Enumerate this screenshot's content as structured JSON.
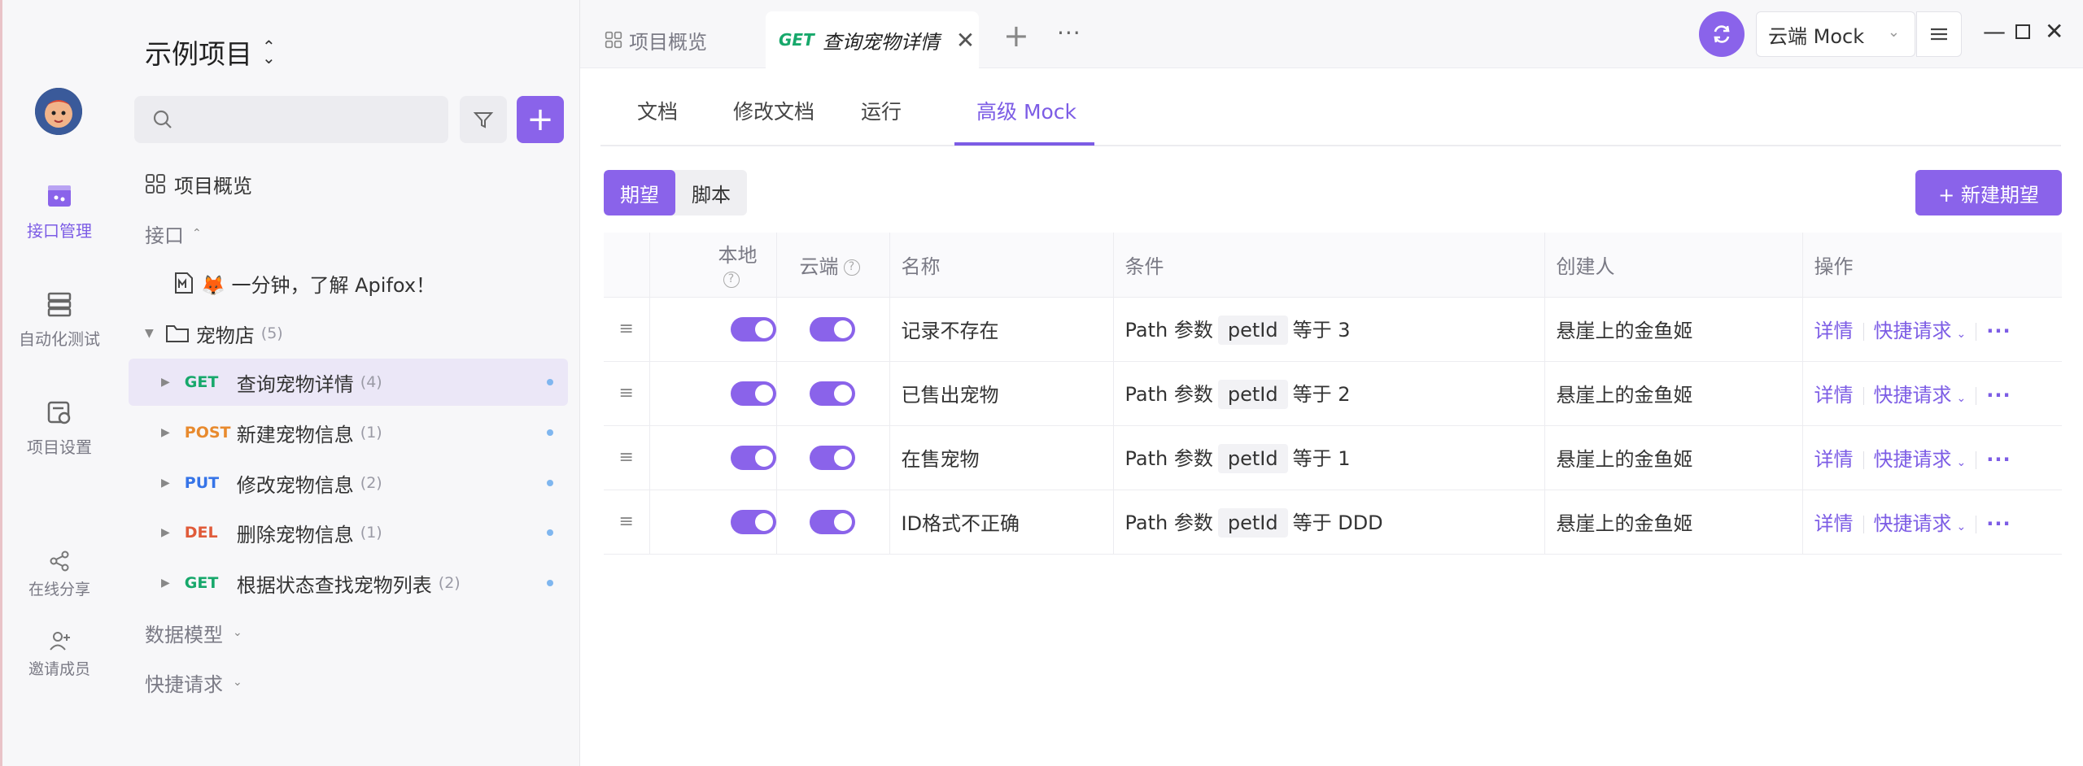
{
  "rail": {
    "items": [
      {
        "label": "接口管理",
        "icon": "api-management-icon"
      },
      {
        "label": "自动化测试",
        "icon": "automation-test-icon"
      },
      {
        "label": "项目设置",
        "icon": "project-settings-icon"
      },
      {
        "label": "在线分享",
        "icon": "share-icon"
      },
      {
        "label": "邀请成员",
        "icon": "invite-member-icon"
      }
    ]
  },
  "sidebar": {
    "project_title": "示例项目",
    "overview": "项目概览",
    "section_api": "接口",
    "intro_doc": "🦊 一分钟，了解 Apifox！",
    "folder": {
      "name": "宠物店",
      "count": "(5)"
    },
    "endpoints": [
      {
        "method": "GET",
        "name": "查询宠物详情",
        "count": "(4)"
      },
      {
        "method": "POST",
        "name": "新建宠物信息",
        "count": "(1)"
      },
      {
        "method": "PUT",
        "name": "修改宠物信息",
        "count": "(2)"
      },
      {
        "method": "DEL",
        "name": "删除宠物信息",
        "count": "(1)"
      },
      {
        "method": "GET",
        "name": "根据状态查找宠物列表",
        "count": "(2)"
      }
    ],
    "section_models": "数据模型",
    "section_quick": "快捷请求"
  },
  "tabbar": {
    "overview_tab": "项目概览",
    "active_tab": {
      "method": "GET",
      "title": "查询宠物详情"
    },
    "env": "云端 Mock"
  },
  "subtabs": [
    "文档",
    "修改文档",
    "运行",
    "高级 Mock"
  ],
  "segment": {
    "expect": "期望",
    "script": "脚本"
  },
  "new_expect": "+ 新建期望",
  "table": {
    "headers": {
      "local": "本地",
      "cloud": "云端",
      "name": "名称",
      "cond": "条件",
      "creator": "创建人",
      "ops": "操作"
    },
    "rows": [
      {
        "name": "记录不存在",
        "cond_prefix": "Path 参数",
        "param": "petId",
        "cond_suffix": "等于 3",
        "creator": "悬崖上的金鱼姬"
      },
      {
        "name": "已售出宠物",
        "cond_prefix": "Path 参数",
        "param": "petId",
        "cond_suffix": "等于 2",
        "creator": "悬崖上的金鱼姬"
      },
      {
        "name": "在售宠物",
        "cond_prefix": "Path 参数",
        "param": "petId",
        "cond_suffix": "等于 1",
        "creator": "悬崖上的金鱼姬"
      },
      {
        "name": "ID格式不正确",
        "cond_prefix": "Path 参数",
        "param": "petId",
        "cond_suffix": "等于 DDD",
        "creator": "悬崖上的金鱼姬"
      }
    ],
    "op_detail": "详情",
    "op_quick": "快捷请求"
  }
}
